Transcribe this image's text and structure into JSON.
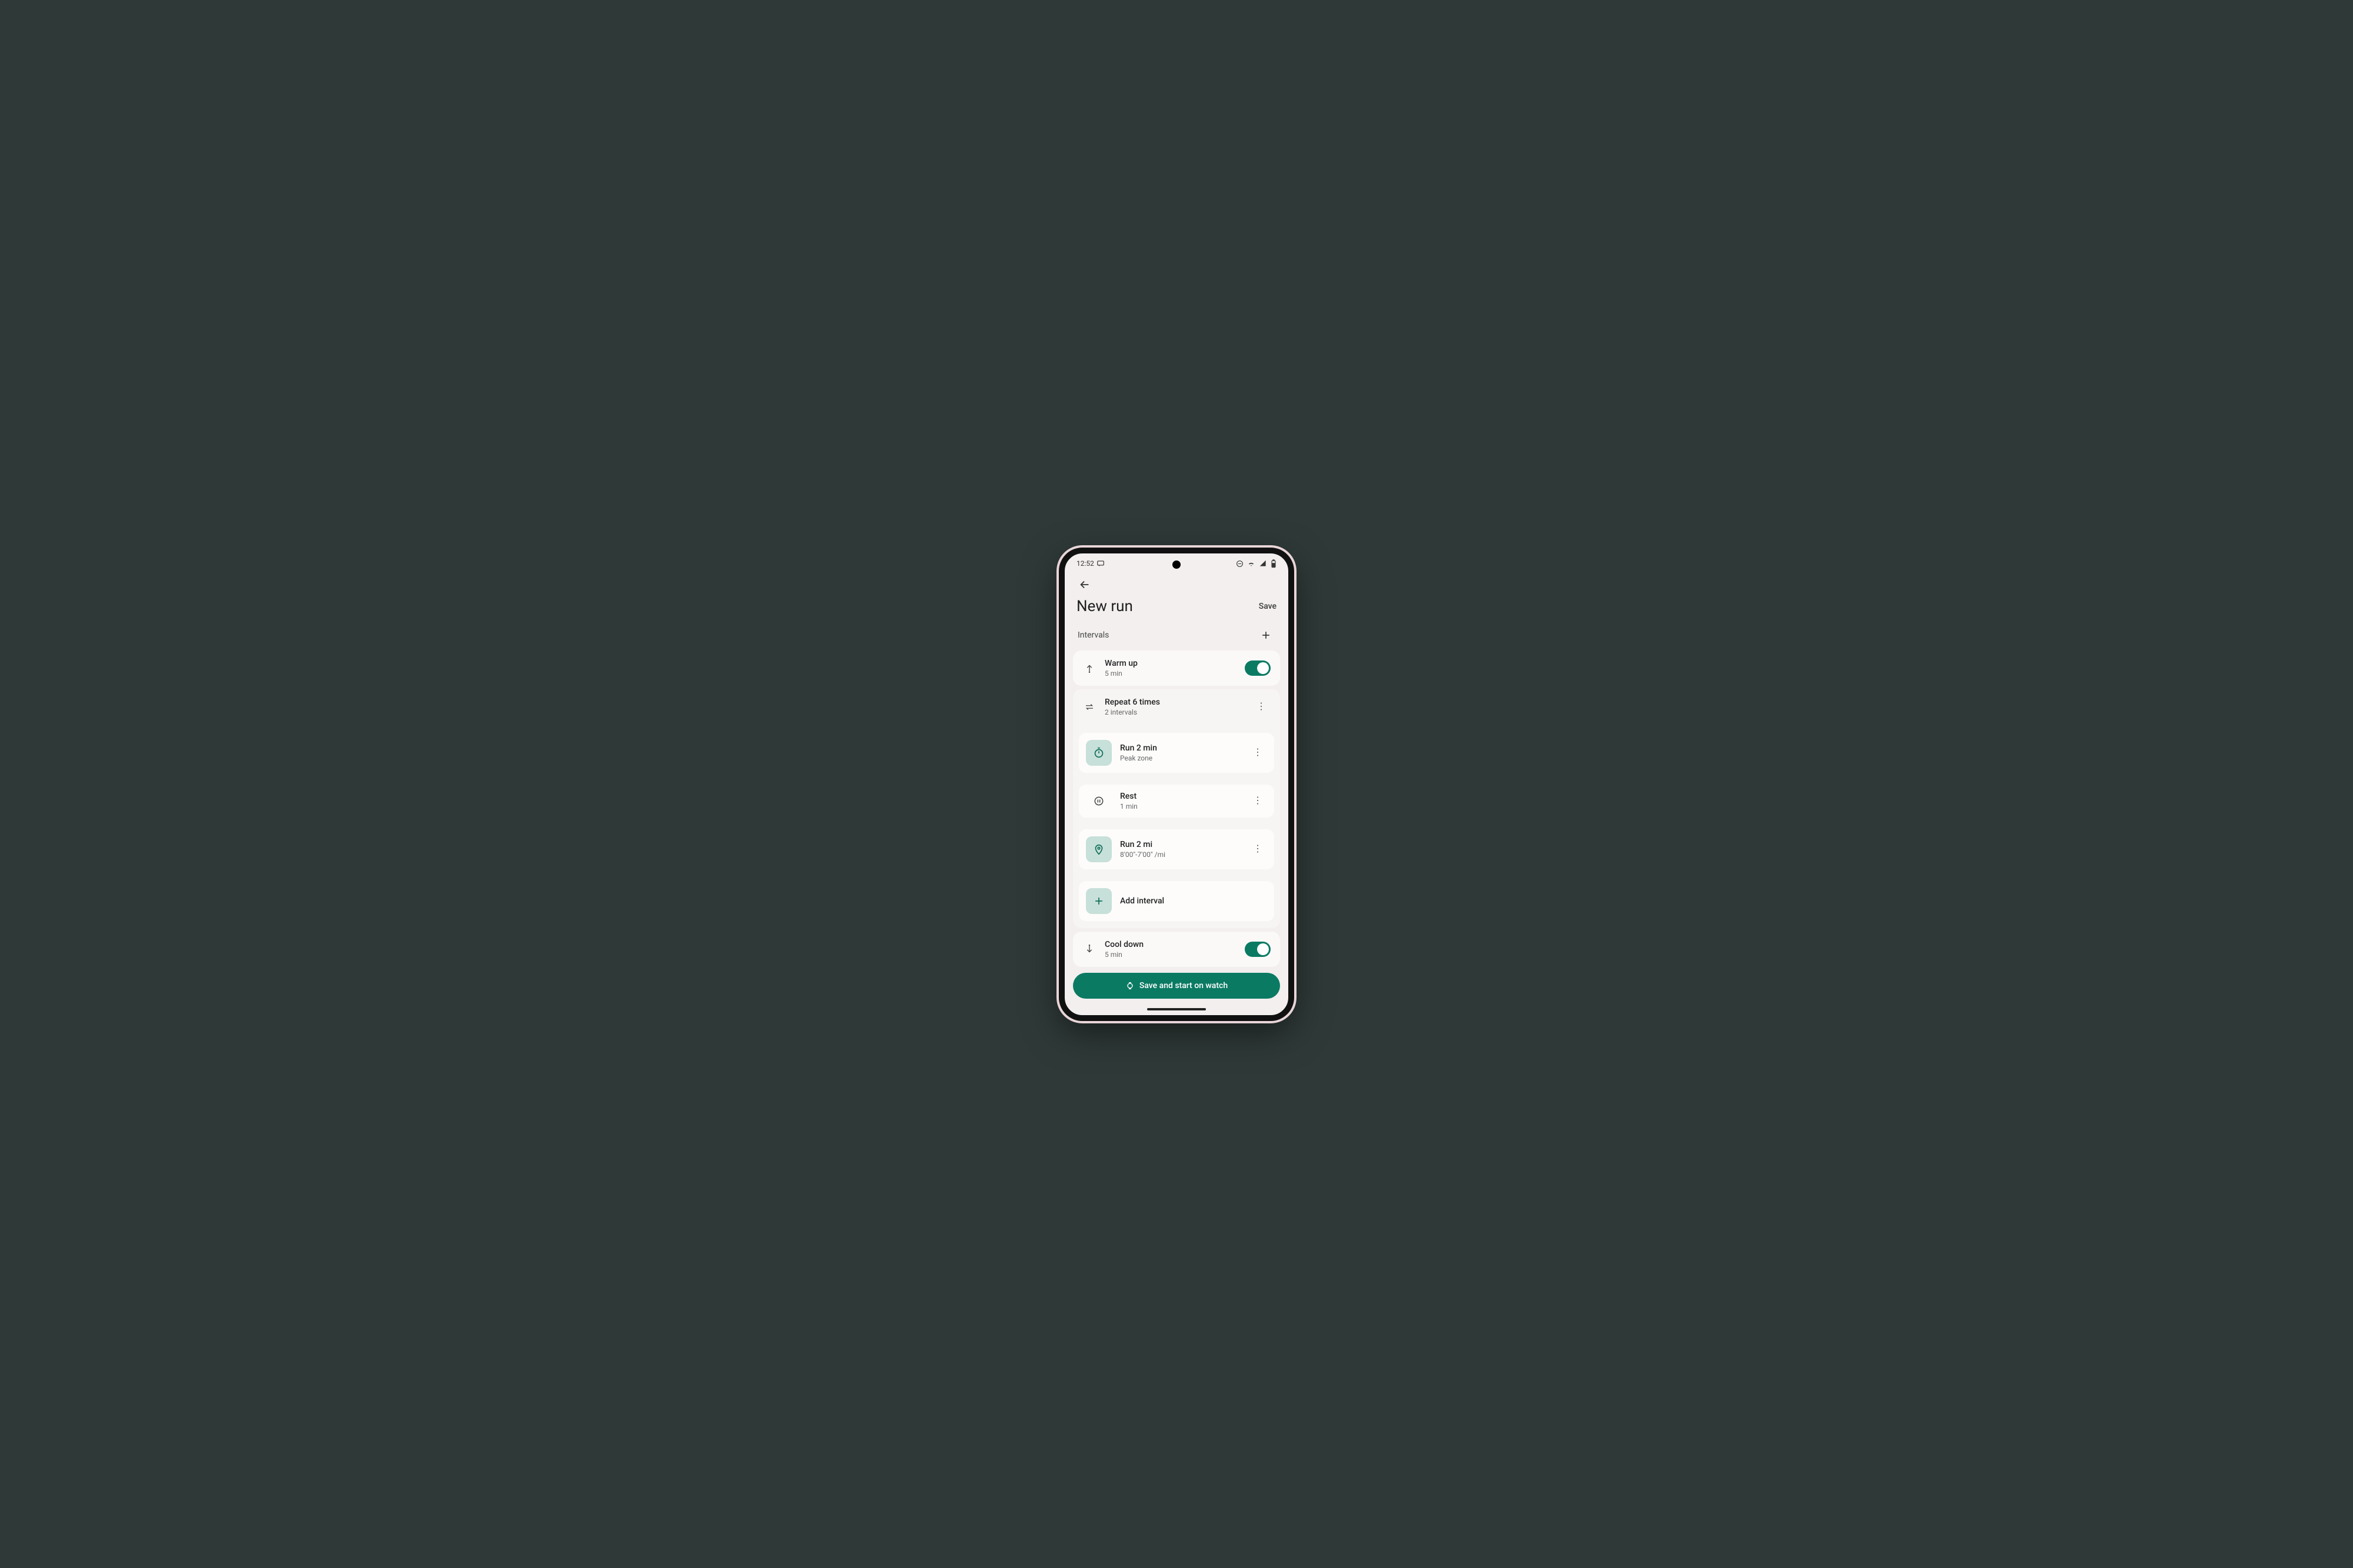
{
  "status": {
    "time": "12:52",
    "icons": [
      "dnd-icon",
      "wifi-icon",
      "signal-icon",
      "battery-icon"
    ]
  },
  "header": {
    "title": "New run",
    "save": "Save"
  },
  "section": {
    "label": "Intervals"
  },
  "warmup": {
    "title": "Warm up",
    "sub": "5 min",
    "enabled": true
  },
  "repeat": {
    "title": "Repeat 6 times",
    "sub": "2 intervals",
    "items": [
      {
        "icon": "timer",
        "title": "Run 2 min",
        "sub": "Peak zone",
        "boxed": true
      },
      {
        "icon": "pause",
        "title": "Rest",
        "sub": "1 min",
        "boxed": false
      },
      {
        "icon": "pin",
        "title": "Run 2 mi",
        "sub": "8'00\"-7'00\" /mi",
        "boxed": true
      }
    ],
    "add": "Add interval"
  },
  "cooldown": {
    "title": "Cool down",
    "sub": "5 min",
    "enabled": true
  },
  "cta": {
    "label": "Save and start on watch"
  }
}
